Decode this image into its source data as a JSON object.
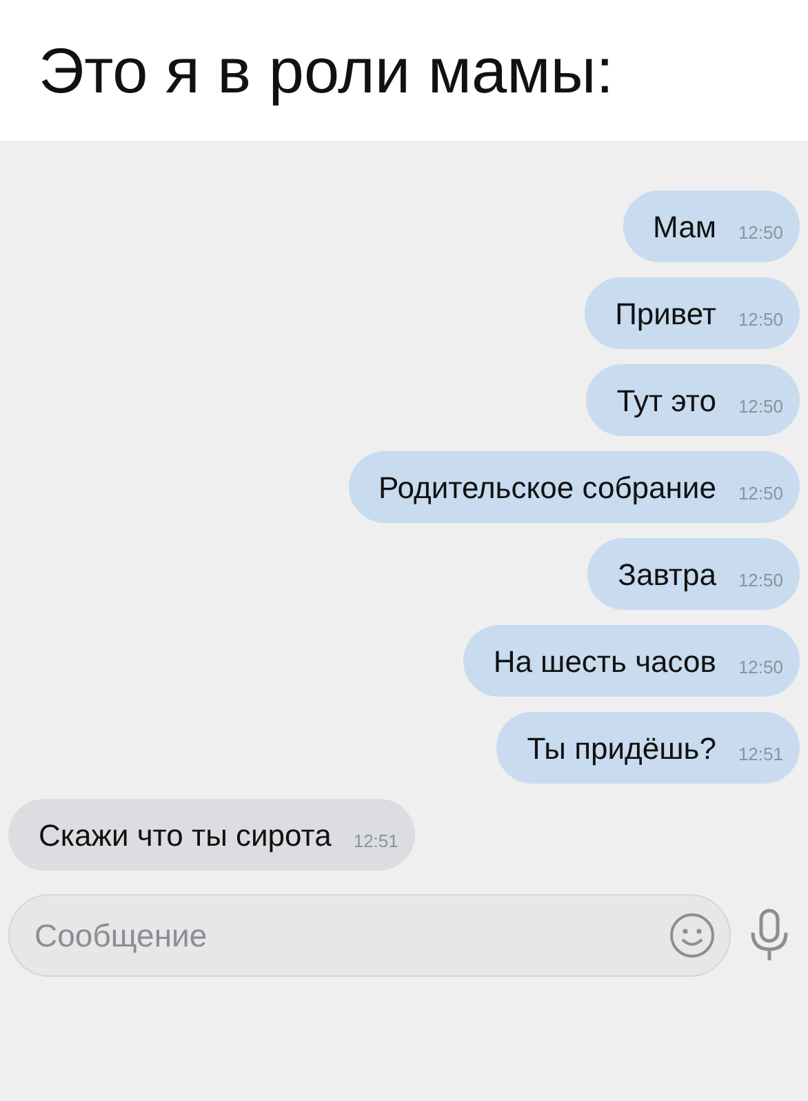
{
  "caption": "Это я в роли мамы:",
  "messages": [
    {
      "kind": "outgoing",
      "text": "Мам",
      "time": "12:50"
    },
    {
      "kind": "outgoing",
      "text": "Привет",
      "time": "12:50"
    },
    {
      "kind": "outgoing",
      "text": "Тут это",
      "time": "12:50"
    },
    {
      "kind": "outgoing",
      "text": "Родительское собрание",
      "time": "12:50"
    },
    {
      "kind": "outgoing",
      "text": "Завтра",
      "time": "12:50"
    },
    {
      "kind": "outgoing",
      "text": "На шесть часов",
      "time": "12:50"
    },
    {
      "kind": "outgoing",
      "text": "Ты придёшь?",
      "time": "12:51"
    },
    {
      "kind": "incoming",
      "text": "Скажи что ты сирота",
      "time": "12:51"
    }
  ],
  "composer": {
    "placeholder": "Сообщение"
  }
}
